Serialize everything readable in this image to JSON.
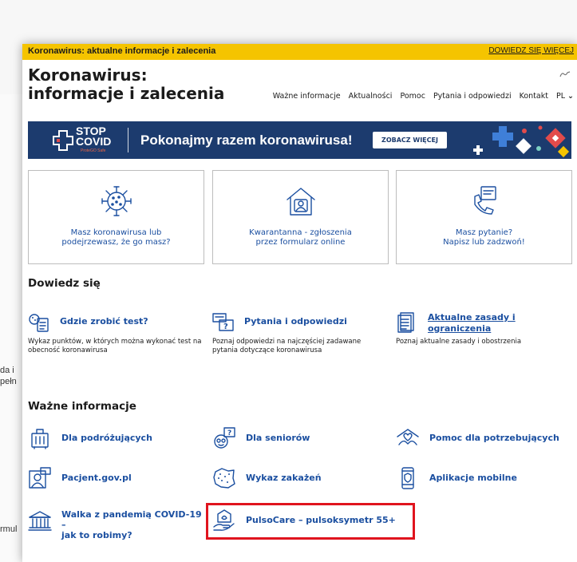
{
  "alert_bar": {
    "text": "Koronawirus: aktualne informacje i zalecenia",
    "link": "DOWIEDZ SIĘ WIĘCEJ"
  },
  "site": {
    "title_line1": "Koronawirus:",
    "title_line2": "informacje i zalecenia"
  },
  "nav": {
    "items": [
      "Ważne informacje",
      "Aktualności",
      "Pomoc",
      "Pytania i odpowiedzi",
      "Kontakt"
    ],
    "lang": "PL",
    "lang_icon": "chevron-down-icon"
  },
  "banner": {
    "logo_line1": "STOP",
    "logo_line2": "COVID",
    "logo_sub": "ProteGO Safe",
    "headline": "Pokonajmy razem koronawirusa!",
    "button": "ZOBACZ WIĘCEJ"
  },
  "cards": [
    {
      "icon": "virus-icon",
      "line1": "Masz koronawirusa lub",
      "line2": "podejrzewasz, że go masz?"
    },
    {
      "icon": "house-person-icon",
      "line1": "Kwarantanna - zgłoszenia",
      "line2": "przez formularz online"
    },
    {
      "icon": "phone-question-icon",
      "line1": "Masz pytanie?",
      "line2": "Napisz lub zadzwoń!"
    }
  ],
  "learn": {
    "title": "Dowiedz się",
    "items": [
      {
        "icon": "test-icon",
        "label": "Gdzie zrobić test?",
        "desc": "Wykaz punktów, w których można wykonać test na obecność koronawirusa"
      },
      {
        "icon": "faq-icon",
        "label": "Pytania i odpowiedzi",
        "desc": "Poznaj odpowiedzi na najczęściej zadawane pytania dotyczące koronawirusa"
      },
      {
        "icon": "rules-icon",
        "label_line1": "Aktualne zasady i",
        "label_line2": "ograniczenia",
        "desc": "Poznaj aktualne zasady i obostrzenia"
      }
    ]
  },
  "important": {
    "title": "Ważne informacje",
    "items": [
      {
        "icon": "luggage-icon",
        "label": "Dla podróżujących"
      },
      {
        "icon": "senior-icon",
        "label": "Dla seniorów"
      },
      {
        "icon": "help-hands-icon",
        "label": "Pomoc dla potrzebujących"
      },
      {
        "icon": "patient-icon",
        "label": "Pacjent.gov.pl"
      },
      {
        "icon": "map-icon",
        "label": "Wykaz zakażeń"
      },
      {
        "icon": "mobile-icon",
        "label": "Aplikacje mobilne"
      },
      {
        "icon": "government-icon",
        "label_line1": "Walka z pandemią COVID-19 –",
        "label_line2": "jak to robimy?"
      },
      {
        "icon": "pulse-oximeter-icon",
        "label": "PulsoCare – pulsoksymetr 55+"
      }
    ]
  },
  "background": {
    "fragment1": "da i",
    "fragment2": "pełn",
    "fragment3": "rmul"
  },
  "colors": {
    "accent_yellow": "#f5c400",
    "link_blue": "#1b4fa0",
    "banner_navy": "#1c3b6e",
    "highlight_red": "#e0141e"
  }
}
